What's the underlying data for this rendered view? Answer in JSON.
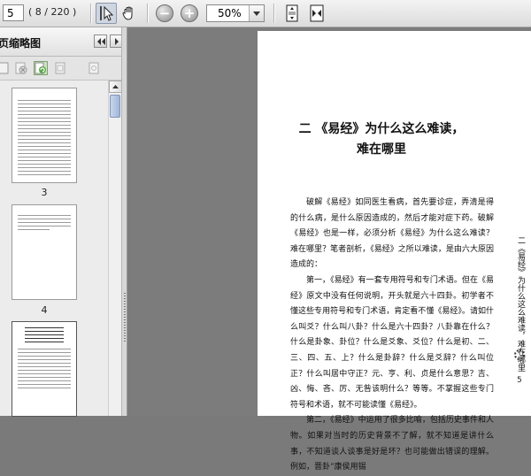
{
  "toolbar": {
    "page_value": "5",
    "page_count": "( 8 / 220 )",
    "zoom_value": "50%",
    "icons": [
      "select-tool-icon",
      "hand-tool-icon",
      "zoom-out-icon",
      "zoom-in-icon",
      "fit-page-icon",
      "fit-width-icon"
    ]
  },
  "sidebar": {
    "title": "页缩略图",
    "thumbnails": [
      {
        "label": "3"
      },
      {
        "label": "4"
      },
      {
        "label": ""
      }
    ]
  },
  "page": {
    "heading_line1": "二 《易经》为什么这么难读，",
    "heading_line2": "难在哪里",
    "paragraphs": [
      "破解《易经》如同医生看病，首先要诊症，弄清是得的什么病，是什么原因造成的，然后才能对症下药。破解《易经》也是一样，必须分析《易经》为什么这么难读？难在哪里？笔者剖析，《易经》之所以难读，是由六大原因造成的：",
      "第一，《易经》有一套专用符号和专门术语。但在《易经》原文中没有任何说明，开头就是六十四卦。初学者不懂这些专用符号和专门术语，肯定看不懂《易经》。请如什么叫爻？什么叫八卦？什么是六十四卦？八卦靠在什么？什么是卦象、卦位？什么是爻象、爻位？什么是初、二、三、四、五、上？什么是卦辞？什么是爻辞？什么叫位正？什么叫居中守正？元、亨、利、贞是什么意思？吉、凶、悔、吝、厉、无咎该明什么？等等。不掌握这些专门符号和术语，就不可能读懂《易经》。",
      "第二，《易经》中运用了很多比喻，包括历史事件和人物。如果对当时的历史背景不了解，就不知道是讲什么事，不知道谈人谈事是好是坏？也可能做出错误的理解。例如，晋卦“康侯用锡"
    ],
    "side_title": "二《易经》为什么这么难读，难在哪里",
    "page_number": "5"
  }
}
